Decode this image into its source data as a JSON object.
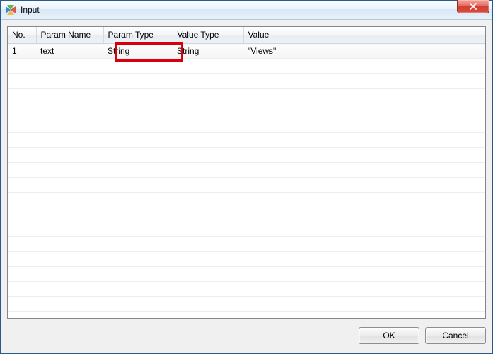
{
  "window": {
    "title": "Input"
  },
  "table": {
    "headers": {
      "no": "No.",
      "paramName": "Param Name",
      "paramType": "Param Type",
      "valueType": "Value Type",
      "value": "Value"
    },
    "rows": [
      {
        "no": "1",
        "paramName": "text",
        "paramType": "String",
        "valueType": "String",
        "value": "\"Views\""
      }
    ]
  },
  "buttons": {
    "ok": "OK",
    "cancel": "Cancel"
  },
  "highlight": {
    "column": "paramType",
    "color": "#d8000c"
  }
}
